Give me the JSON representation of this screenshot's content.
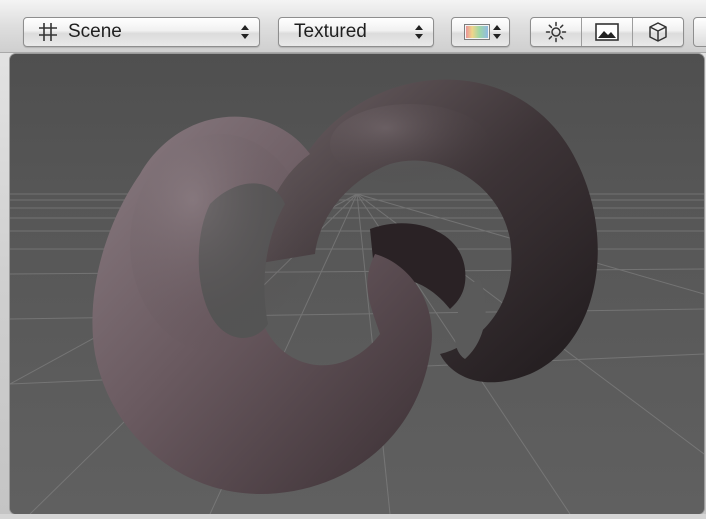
{
  "toolbar": {
    "view_menu": {
      "label": "Scene",
      "icon": "grid-icon"
    },
    "render_mode_menu": {
      "label": "Textured"
    },
    "color_menu": {
      "icon": "color-swatch-icon"
    },
    "toggle_buttons": [
      {
        "icon": "sun-lighting-icon"
      },
      {
        "icon": "image-icon"
      },
      {
        "icon": "cube-icon"
      }
    ]
  },
  "viewport": {
    "object": "knot-mesh",
    "background_color": "#5b5b5b",
    "grid_color": "#8a8a8a",
    "mesh_color": "#6e5e63"
  },
  "colors": {
    "toolbar_bg": "#dedede",
    "button_border": "#8e8e8e"
  }
}
